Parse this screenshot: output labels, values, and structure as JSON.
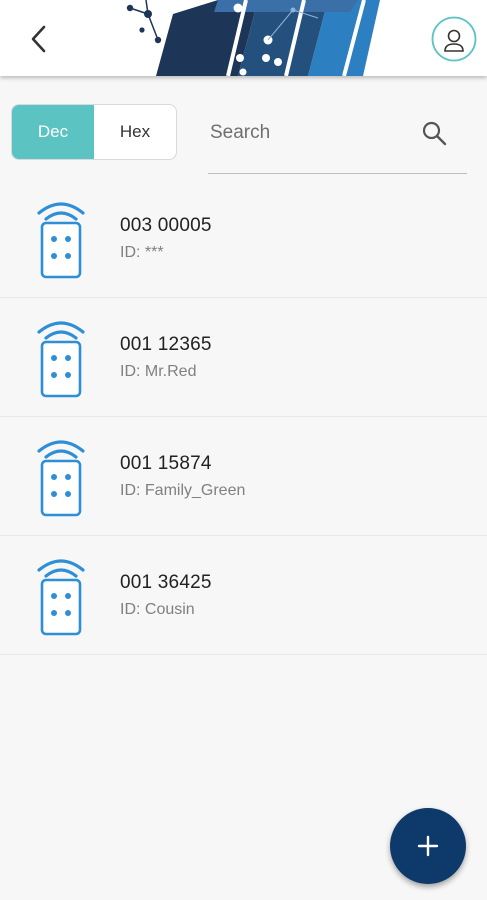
{
  "header": {
    "back_icon": "chevron-left-icon",
    "logo": "cube-network-logo",
    "avatar_icon": "user-profile-icon"
  },
  "format_toggle": {
    "options": [
      "Dec",
      "Hex"
    ],
    "selected": "Dec"
  },
  "search": {
    "placeholder": "Search",
    "value": "",
    "icon": "search-icon"
  },
  "remotes": [
    {
      "code": "003 00005",
      "id_label": "ID: ***",
      "icon": "remote-control-icon"
    },
    {
      "code": "001 12365",
      "id_label": "ID: Mr.Red",
      "icon": "remote-control-icon"
    },
    {
      "code": "001 15874",
      "id_label": "ID: Family_Green",
      "icon": "remote-control-icon"
    },
    {
      "code": "001 36425",
      "id_label": "ID: Cousin",
      "icon": "remote-control-icon"
    }
  ],
  "fab": {
    "label": "+",
    "icon": "plus-icon"
  },
  "colors": {
    "accent_teal": "#5cc3c3",
    "icon_blue": "#2e8fd6",
    "fab_navy": "#0e3a6b",
    "logo_dark": "#1d3557",
    "logo_blue": "#2c7fc0"
  }
}
